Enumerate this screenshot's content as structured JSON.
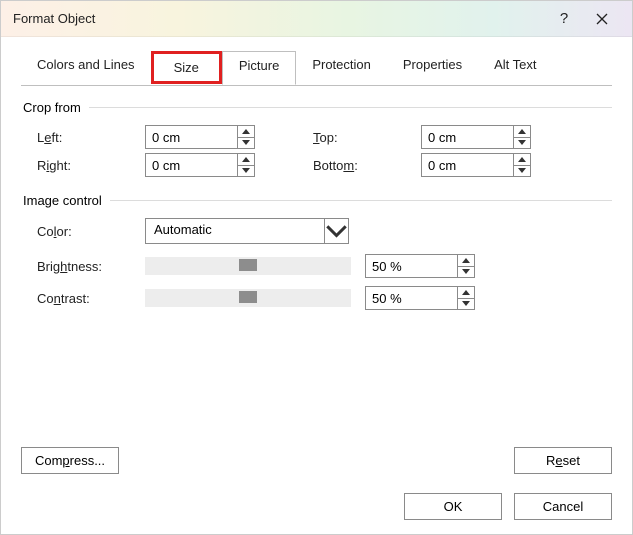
{
  "title": "Format Object",
  "help_label": "?",
  "tabs": {
    "colors_lines": "Colors and Lines",
    "size": "Size",
    "picture": "Picture",
    "protection": "Protection",
    "properties": "Properties",
    "alt_text": "Alt Text"
  },
  "group": {
    "crop_from": "Crop from",
    "image_control": "Image control"
  },
  "labels": {
    "left_pre": "L",
    "left_u": "e",
    "left_post": "ft:",
    "right_pre": "R",
    "right_u": "i",
    "right_post": "ght:",
    "top_pre": "",
    "top_u": "T",
    "top_post": "op:",
    "bottom_pre": "Botto",
    "bottom_u": "m",
    "bottom_post": ":",
    "color_pre": "Co",
    "color_u": "l",
    "color_post": "or:",
    "brightness_pre": "Brig",
    "brightness_u": "h",
    "brightness_post": "tness:",
    "contrast_pre": "Co",
    "contrast_u": "n",
    "contrast_post": "trast:"
  },
  "values": {
    "left": "0 cm",
    "right": "0 cm",
    "top": "0 cm",
    "bottom": "0 cm",
    "color": "Automatic",
    "brightness": "50 %",
    "contrast": "50 %"
  },
  "buttons": {
    "compress_pre": "Com",
    "compress_u": "p",
    "compress_post": "ress...",
    "reset_pre": "R",
    "reset_u": "e",
    "reset_post": "set",
    "ok": "OK",
    "cancel": "Cancel"
  }
}
